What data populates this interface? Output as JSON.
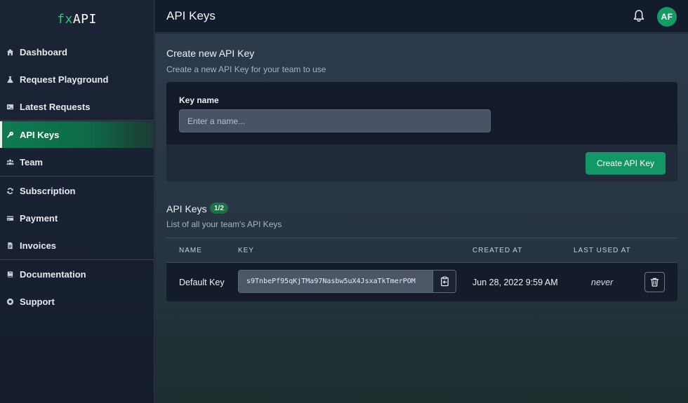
{
  "logo": {
    "fx": "fx",
    "api": "API"
  },
  "sidebar": {
    "items": [
      {
        "label": "Dashboard",
        "icon": "home-icon"
      },
      {
        "label": "Request Playground",
        "icon": "flask-icon"
      },
      {
        "label": "Latest Requests",
        "icon": "terminal-icon"
      },
      {
        "label": "API Keys",
        "icon": "key-icon",
        "active": true
      },
      {
        "label": "Team",
        "icon": "users-icon"
      },
      {
        "label": "Subscription",
        "icon": "refresh-icon"
      },
      {
        "label": "Payment",
        "icon": "credit-card-icon"
      },
      {
        "label": "Invoices",
        "icon": "document-icon"
      },
      {
        "label": "Documentation",
        "icon": "book-icon"
      },
      {
        "label": "Support",
        "icon": "lifebuoy-icon"
      }
    ]
  },
  "header": {
    "title": "API Keys",
    "avatar_initials": "AF"
  },
  "create": {
    "title": "Create new API Key",
    "subtitle": "Create a new API Key for your team to use",
    "field_label": "Key name",
    "placeholder": "Enter a name...",
    "button": "Create API Key"
  },
  "keys": {
    "title": "API Keys",
    "count_badge": "1/2",
    "subtitle": "List of all your team's API Keys",
    "columns": {
      "name": "NAME",
      "key": "KEY",
      "created": "CREATED AT",
      "last_used": "LAST USED AT"
    },
    "rows": [
      {
        "name": "Default Key",
        "key": "s9TnbePf95qKjTMa97Nasbw5uX4JsxaTkTmerPOM",
        "created": "Jun 28, 2022 9:59 AM",
        "last_used": "never"
      }
    ]
  },
  "colors": {
    "accent": "#139766",
    "sidebar_active": "#0f7b52",
    "background": "#1e2836"
  }
}
